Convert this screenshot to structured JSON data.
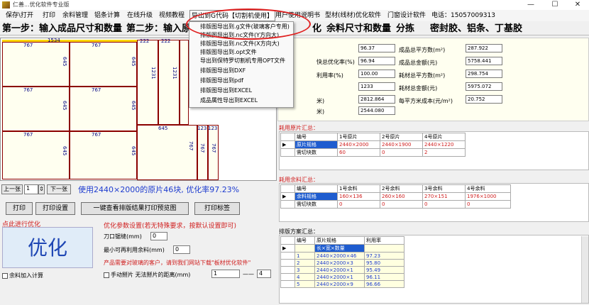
{
  "window": {
    "title": "仁善...优化软件专业版"
  },
  "menu": [
    "保存\\打开",
    "打印",
    "余料管理",
    "铝条计算",
    "在线升级",
    "视频教程",
    "导出到G代码【切割机使用】",
    "用户使用说明书",
    "型材(线材)优化软件",
    "门窗设计软件",
    "电话：15057009313"
  ],
  "steps": [
    "第一步：输入成品尺寸和数量",
    "第二步：输入原",
    "化",
    "余料尺寸和数量",
    "分拣",
    "密封胶、铝条、丁基胶"
  ],
  "dropdown": [
    "排版图导出到.g文件(玻璃客户专用)",
    "排版图导出到.nc文件(Y方向大)",
    "排版图导出到.nc文件(X方向大)",
    "排版图导出到.opt文件",
    "导出到保特罗切割机专用OPT文件",
    "排版图导出到DXF",
    "排版图导出到pdf",
    "排版图导出到EXCEL",
    "成品属性导出到EXCEL"
  ],
  "layout_labels": {
    "top_width": "1534",
    "w767": "767",
    "h645": "645",
    "w222": "222",
    "w1231": "1231",
    "w123": "123"
  },
  "nav": {
    "prev": "上一张",
    "page": "1",
    "next": "下一张",
    "info": "使用2440×2000的原片46块, 优化率97.23%"
  },
  "buttons": {
    "print": "打印",
    "print_setup": "打印设置",
    "preview": "一键查看排版结果打印预览图",
    "print_label": "打印标签"
  },
  "optimize": {
    "hint": "点此进行优化",
    "label": "优化",
    "remain_check": "余料加入计算"
  },
  "params": {
    "title": "优化参数设置(若无特殊要求，按默认设置即可)",
    "kerf_label": "刀口锯缝(mm)",
    "kerf_value": "0",
    "min_remain_label": "最小可再利用余料(mm)",
    "min_remain_value": "0",
    "ad": "产品需要对玻璃的客户，请到我们网站下载\"板材优化软件\"",
    "manual_label": "手动掰片 无法掰片的距离(mm)",
    "manual_from": "1",
    "manual_dash": "——",
    "manual_to": "4"
  },
  "stats": {
    "left_labels": [
      "",
      "快总优化率(%)",
      "利用率(%)",
      "",
      "米)",
      "米)"
    ],
    "left_values": [
      "96.37",
      "96.94",
      "100.00",
      "1233",
      "2812.864",
      "2544.080"
    ],
    "right_labels": [
      "成品总平方数(m²)",
      "成品总金额(元)",
      "耗材总平方数(m²)",
      "耗材总金额(元)",
      "每平方米成本(元/m²)"
    ],
    "right_values": [
      "287.922",
      "5758.441",
      "298.754",
      "5975.072",
      "20.752"
    ]
  },
  "raw_sheet": {
    "title": "耗用原片汇总：",
    "headers": [
      "编号",
      "1号原片",
      "2号原片",
      "4号原片"
    ],
    "rows": [
      [
        "原片规格",
        "2440×2000",
        "2440×1900",
        "2440×1220"
      ],
      [
        "需切块数",
        "60",
        "0",
        "2"
      ]
    ]
  },
  "remain": {
    "title": "耗用余料汇总：",
    "headers": [
      "编号",
      "1号余料",
      "2号余料",
      "3号余料",
      "4号余料"
    ],
    "rows": [
      [
        "余料规格",
        "160×136",
        "260×160",
        "270×151",
        "1976×1000"
      ],
      [
        "需切块数",
        "0",
        "0",
        "0",
        "0"
      ]
    ]
  },
  "plan": {
    "title": "排版方案汇总：",
    "headers": [
      "编号",
      "原片规格",
      "利用率"
    ],
    "rows": [
      [
        "",
        "长×宽×数量",
        ""
      ],
      [
        "1",
        "2440×2000×46",
        "97.23"
      ],
      [
        "2",
        "2440×2000×3",
        "95.80"
      ],
      [
        "3",
        "2440×2000×1",
        "95.49"
      ],
      [
        "4",
        "2440×2000×1",
        "96.11"
      ],
      [
        "5",
        "2440×2000×9",
        "96.66"
      ]
    ]
  }
}
